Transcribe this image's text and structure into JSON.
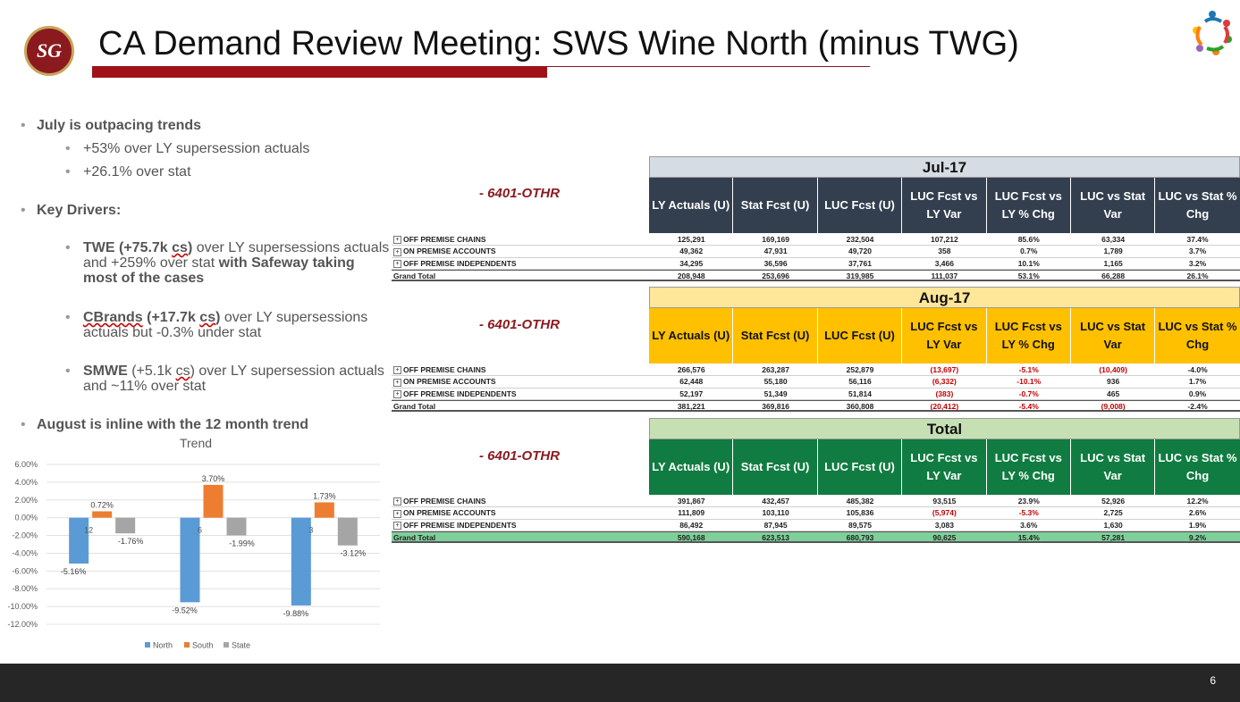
{
  "header": {
    "logo_text": "SG",
    "title": "CA Demand Review Meeting: SWS Wine North (minus TWG)"
  },
  "bullets": {
    "july": "July is outpacing trends",
    "july_sub1": "+53% over LY supersession actuals",
    "july_sub2": "+26.1% over stat",
    "key_drivers": "Key Drivers:",
    "twe_bold": "TWE (+75.7k ",
    "twe_cs": "cs",
    "twe_close": ")",
    "twe_rest": " over LY supersessions actuals and +259% over stat ",
    "twe_bold2": "with Safeway taking most of the cases",
    "cbrands_bold": "CBrands",
    "cbrands_bold2": " (+17.7k ",
    "cbrands_cs": "cs",
    "cbrands_close": ")",
    "cbrands_rest": " over LY supersessions actuals but -0.3% under stat",
    "smwe_name": "SMWE",
    "smwe_mid": " (+5.1k ",
    "smwe_cs": "cs",
    "smwe_rest": ") over LY supersession actuals and ~11% over stat",
    "august": "August is inline with the 12 month trend"
  },
  "chart_data": {
    "type": "bar",
    "title": "Trend",
    "categories": [
      "12",
      "6",
      "3"
    ],
    "series": [
      {
        "name": "North",
        "values": [
          -5.16,
          -9.52,
          -9.88
        ],
        "labels": [
          "-5.16%",
          "-9.52%",
          "-9.88%"
        ],
        "color": "#5b9bd5"
      },
      {
        "name": "South",
        "values": [
          0.72,
          3.7,
          1.73
        ],
        "labels": [
          "0.72%",
          "3.70%",
          "1.73%"
        ],
        "color": "#ed7d31"
      },
      {
        "name": "State",
        "values": [
          -1.76,
          -1.99,
          -3.12
        ],
        "labels": [
          "-1.76%",
          "-1.99%",
          "-3.12%"
        ],
        "color": "#a5a5a5"
      }
    ],
    "ylim": [
      -12,
      6
    ],
    "yticks": [
      6,
      4,
      2,
      0,
      -2,
      -4,
      -6,
      -8,
      -10,
      -12
    ],
    "ytick_labels": [
      "6.00%",
      "4.00%",
      "2.00%",
      "0.00%",
      "-2.00%",
      "-4.00%",
      "-6.00%",
      "-8.00%",
      "-10.00%",
      "-12.00%"
    ],
    "grid": true,
    "legend": "bottom"
  },
  "tables": [
    {
      "label": "- 6401-OTHR",
      "period": "Jul-17",
      "period_bg": "#d6dce4",
      "header_bg": "#333f4f",
      "header_color": "#ffffff",
      "columns": [
        "LY Actuals (U)",
        "Stat Fcst (U)",
        "LUC Fcst (U)",
        "LUC Fcst vs LY Var",
        "LUC Fcst vs LY % Chg",
        "LUC vs Stat Var",
        "LUC vs Stat % Chg"
      ],
      "rows": [
        {
          "label": "OFF PREMISE CHAINS",
          "values": [
            "125,291",
            "169,169",
            "232,504",
            "107,212",
            "85.6%",
            "63,334",
            "37.4%"
          ]
        },
        {
          "label": "ON PREMISE ACCOUNTS",
          "values": [
            "49,362",
            "47,931",
            "49,720",
            "358",
            "0.7%",
            "1,789",
            "3.7%"
          ]
        },
        {
          "label": "OFF PREMISE INDEPENDENTS",
          "values": [
            "34,295",
            "36,596",
            "37,761",
            "3,466",
            "10.1%",
            "1,165",
            "3.2%"
          ]
        }
      ],
      "grand_total": {
        "label": "Grand Total",
        "values": [
          "208,948",
          "253,696",
          "319,985",
          "111,037",
          "53.1%",
          "66,288",
          "26.1%"
        ]
      }
    },
    {
      "label": "- 6401-OTHR",
      "period": "Aug-17",
      "period_bg": "#ffe699",
      "header_bg": "#ffc000",
      "header_color": "#111111",
      "columns": [
        "LY Actuals (U)",
        "Stat Fcst (U)",
        "LUC Fcst (U)",
        "LUC Fcst vs LY Var",
        "LUC Fcst vs LY % Chg",
        "LUC vs Stat Var",
        "LUC vs Stat % Chg"
      ],
      "rows": [
        {
          "label": "OFF PREMISE CHAINS",
          "values": [
            "266,576",
            "263,287",
            "252,879",
            "(13,697)",
            "-5.1%",
            "(10,409)",
            "-4.0%"
          ]
        },
        {
          "label": "ON PREMISE ACCOUNTS",
          "values": [
            "62,448",
            "55,180",
            "56,116",
            "(6,332)",
            "-10.1%",
            "936",
            "1.7%"
          ]
        },
        {
          "label": "OFF PREMISE INDEPENDENTS",
          "values": [
            "52,197",
            "51,349",
            "51,814",
            "(383)",
            "-0.7%",
            "465",
            "0.9%"
          ]
        }
      ],
      "grand_total": {
        "label": "Grand Total",
        "values": [
          "381,221",
          "369,816",
          "360,808",
          "(20,412)",
          "-5.4%",
          "(9,008)",
          "-2.4%"
        ]
      }
    },
    {
      "label": "- 6401-OTHR",
      "period": "Total",
      "period_bg": "#c6e0b4",
      "header_bg": "#107c41",
      "header_color": "#ffffff",
      "columns": [
        "LY Actuals (U)",
        "Stat Fcst (U)",
        "LUC Fcst (U)",
        "LUC Fcst vs LY Var",
        "LUC Fcst vs LY % Chg",
        "LUC vs Stat Var",
        "LUC vs Stat % Chg"
      ],
      "rows": [
        {
          "label": "OFF PREMISE CHAINS",
          "values": [
            "391,867",
            "432,457",
            "485,382",
            "93,515",
            "23.9%",
            "52,926",
            "12.2%"
          ]
        },
        {
          "label": "ON PREMISE ACCOUNTS",
          "values": [
            "111,809",
            "103,110",
            "105,836",
            "(5,974)",
            "-5.3%",
            "2,725",
            "2.6%"
          ]
        },
        {
          "label": "OFF PREMISE INDEPENDENTS",
          "values": [
            "86,492",
            "87,945",
            "89,575",
            "3,083",
            "3.6%",
            "1,630",
            "1.9%"
          ]
        }
      ],
      "grand_total": {
        "label": "Grand Total",
        "values": [
          "590,168",
          "623,513",
          "680,793",
          "90,625",
          "15.4%",
          "57,281",
          "9.2%"
        ],
        "bg": "#7fcf9a"
      }
    }
  ],
  "footer": {
    "page_number": "6"
  }
}
